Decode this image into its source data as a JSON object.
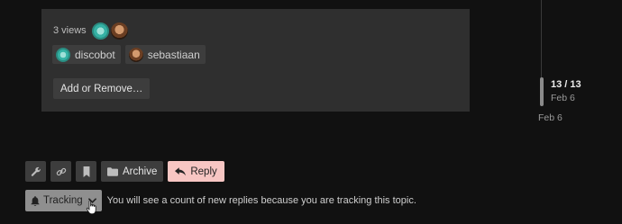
{
  "views_panel": {
    "views_text": "3 views",
    "users": [
      {
        "name": "discobot",
        "avatar": "discobot-avatar"
      },
      {
        "name": "sebastiaan",
        "avatar": "sebastiaan-avatar"
      }
    ],
    "add_remove_label": "Add or Remove…"
  },
  "timeline": {
    "position": "13 / 13",
    "current_date": "Feb 6",
    "end_date": "Feb 6"
  },
  "footer": {
    "buttons": [
      {
        "name": "admin",
        "icon": "wrench-icon"
      },
      {
        "name": "copy-link",
        "icon": "link-icon"
      },
      {
        "name": "bookmark",
        "icon": "bookmark-icon"
      }
    ],
    "archive_label": "Archive",
    "archive_icon": "folder-icon",
    "reply_label": "Reply",
    "reply_icon": "reply-arrow-icon",
    "reply_color": "#f7c6c3"
  },
  "notifications": {
    "level_label": "Tracking",
    "level_icon": "bell-icon",
    "description": "You will see a count of new replies because you are tracking this topic."
  },
  "colors": {
    "background": "#111111",
    "panel": "#2f2f2f",
    "button": "#3d3d3d",
    "tracking_button": "#8f8f8f"
  }
}
